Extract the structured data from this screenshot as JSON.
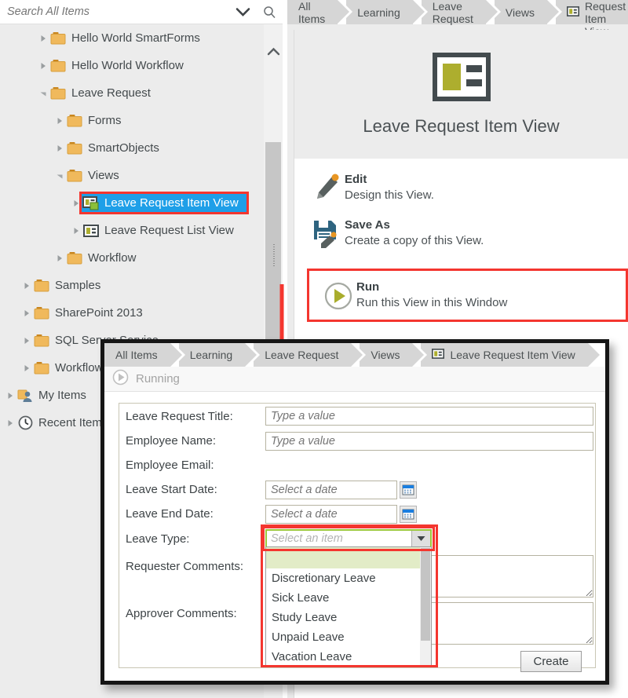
{
  "search": {
    "placeholder": "Search All Items",
    "value": "",
    "expand_icon": "chevron-down-icon",
    "search_icon": "search-icon"
  },
  "tree": {
    "items": [
      {
        "label": "Hello World SmartForms",
        "indent": 2,
        "icon": "folder-icon",
        "expander": "collapsed",
        "selected": false
      },
      {
        "label": "Hello World Workflow",
        "indent": 2,
        "icon": "folder-icon",
        "expander": "collapsed",
        "selected": false
      },
      {
        "label": "Leave Request",
        "indent": 2,
        "icon": "folder-icon",
        "expander": "expanded",
        "selected": false
      },
      {
        "label": "Forms",
        "indent": 3,
        "icon": "folder-icon",
        "expander": "collapsed",
        "selected": false
      },
      {
        "label": "SmartObjects",
        "indent": 3,
        "icon": "folder-icon",
        "expander": "collapsed",
        "selected": false
      },
      {
        "label": "Views",
        "indent": 3,
        "icon": "folder-icon",
        "expander": "expanded",
        "selected": false
      },
      {
        "label": "Leave Request Item View",
        "indent": 4,
        "icon": "item-view-icon",
        "expander": "collapsed",
        "selected": true
      },
      {
        "label": "Leave Request List View",
        "indent": 4,
        "icon": "list-view-icon",
        "expander": "collapsed",
        "selected": false
      },
      {
        "label": "Workflow",
        "indent": 3,
        "icon": "folder-icon",
        "expander": "collapsed",
        "selected": false
      },
      {
        "label": "Samples",
        "indent": 1,
        "icon": "folder-icon",
        "expander": "collapsed",
        "selected": false
      },
      {
        "label": "SharePoint 2013",
        "indent": 1,
        "icon": "folder-icon",
        "expander": "collapsed",
        "selected": false
      },
      {
        "label": "SQL Server Service",
        "indent": 1,
        "icon": "folder-icon",
        "expander": "collapsed",
        "selected": false
      },
      {
        "label": "Workflow",
        "indent": 1,
        "icon": "folder-icon",
        "expander": "collapsed",
        "selected": false
      },
      {
        "label": "My Items",
        "indent": 0,
        "icon": "my-items-icon",
        "expander": "collapsed",
        "selected": false
      },
      {
        "label": "Recent Items",
        "indent": 0,
        "icon": "recent-items-icon",
        "expander": "collapsed",
        "selected": false
      }
    ]
  },
  "main": {
    "breadcrumb": [
      {
        "label": "All Items",
        "icon": null
      },
      {
        "label": "Learning",
        "icon": null
      },
      {
        "label": "Leave Request",
        "icon": null
      },
      {
        "label": "Views",
        "icon": null
      },
      {
        "label": "Leave Request Item View",
        "icon": "item-view-icon"
      }
    ],
    "hero_title": "Leave Request Item View",
    "hero_icon": "item-view-icon",
    "actions": [
      {
        "title": "Edit",
        "desc": "Design this View.",
        "icon": "pencil-icon",
        "highlighted": false
      },
      {
        "title": "Save As",
        "desc": "Create a copy of this View.",
        "icon": "save-as-icon",
        "highlighted": false
      },
      {
        "title": "Run",
        "desc": "Run this View in this Window",
        "icon": "run-icon",
        "highlighted": true
      }
    ]
  },
  "annotations": {
    "highlight_color": "#f4362f",
    "arrow": "down-arrow-annotation"
  },
  "dialog": {
    "breadcrumb": [
      {
        "label": "All Items",
        "icon": null
      },
      {
        "label": "Learning",
        "icon": null
      },
      {
        "label": "Leave Request",
        "icon": null
      },
      {
        "label": "Views",
        "icon": null
      },
      {
        "label": "Leave Request Item View",
        "icon": "item-view-icon"
      }
    ],
    "status": "Running",
    "status_icon": "run-icon",
    "form": {
      "fields": [
        {
          "label": "Leave Request Title:",
          "type": "text",
          "placeholder": "Type a value",
          "value": ""
        },
        {
          "label": "Employee Name:",
          "type": "text",
          "placeholder": "Type a value",
          "value": ""
        },
        {
          "label": "Employee Email:",
          "type": "none",
          "placeholder": "",
          "value": ""
        },
        {
          "label": "Leave Start Date:",
          "type": "date",
          "placeholder": "Select a date",
          "value": ""
        },
        {
          "label": "Leave End Date:",
          "type": "date",
          "placeholder": "Select a date",
          "value": ""
        },
        {
          "label": "Leave Type:",
          "type": "combo",
          "placeholder": "Select an item",
          "value": ""
        },
        {
          "label": "Requester Comments:",
          "type": "textarea",
          "placeholder": "",
          "value": ""
        },
        {
          "label": "Approver Comments:",
          "type": "textarea",
          "placeholder": "",
          "value": ""
        }
      ],
      "dropdown": {
        "open": true,
        "options": [
          "",
          "Discretionary Leave",
          "Sick Leave",
          "Study Leave",
          "Unpaid Leave",
          "Vacation Leave"
        ],
        "selected_index": 0
      },
      "submit_label": "Create"
    }
  }
}
